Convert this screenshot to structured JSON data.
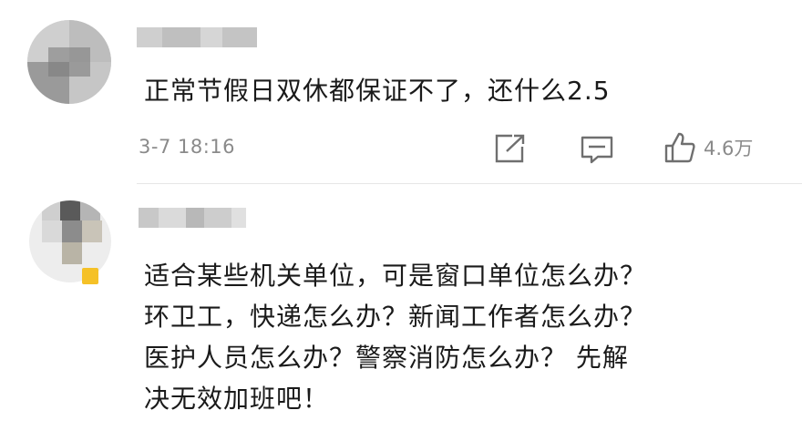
{
  "comments": [
    {
      "text": "正常节假日双休都保证不了，还什么2.5",
      "time": "3-7 18:16",
      "likes": "4.6万",
      "icons": [
        "share-icon",
        "comment-icon",
        "like-icon"
      ]
    },
    {
      "text": "适合某些机关单位，可是窗口单位怎么办？\n环卫工，快递怎么办？新闻工作者怎么办？\n医护人员怎么办？警察消防怎么办？ 先解\n决无效加班吧！"
    }
  ]
}
